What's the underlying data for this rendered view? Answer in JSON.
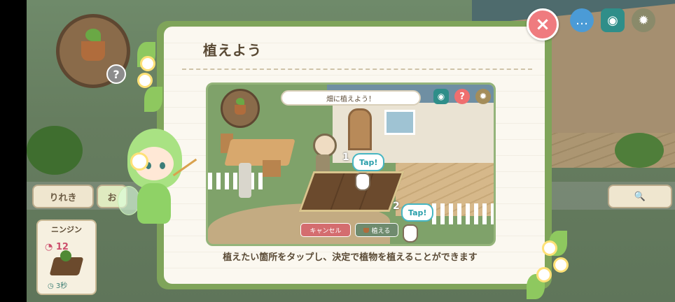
{
  "dialog": {
    "title": "植えよう",
    "instruction": "植えたい箇所をタップし、決定で植物を植えることができます",
    "close_label": "×"
  },
  "tutorial": {
    "speech": "畑に植えよう！",
    "tap1_label": "Tap!",
    "tap2_label": "Tap!",
    "step1": "1",
    "step2": "2",
    "cancel_label": "キャンセル",
    "plant_label": "植える"
  },
  "background": {
    "history_tab": "りれき",
    "osusume_tab": "お",
    "search_icon": "🔍",
    "help_icon": "?"
  },
  "item_card": {
    "name": "ニンジン",
    "level": "12",
    "time": "3秒"
  },
  "icons": {
    "close": "close-icon",
    "chat": "chat-icon",
    "camera": "camera-icon",
    "gear": "gear-icon",
    "help": "help-icon",
    "search": "search-icon"
  },
  "colors": {
    "dialog_frame": "#7fa45a",
    "close_button": "#ef7b7f",
    "tap_accent": "#46b6c2"
  }
}
